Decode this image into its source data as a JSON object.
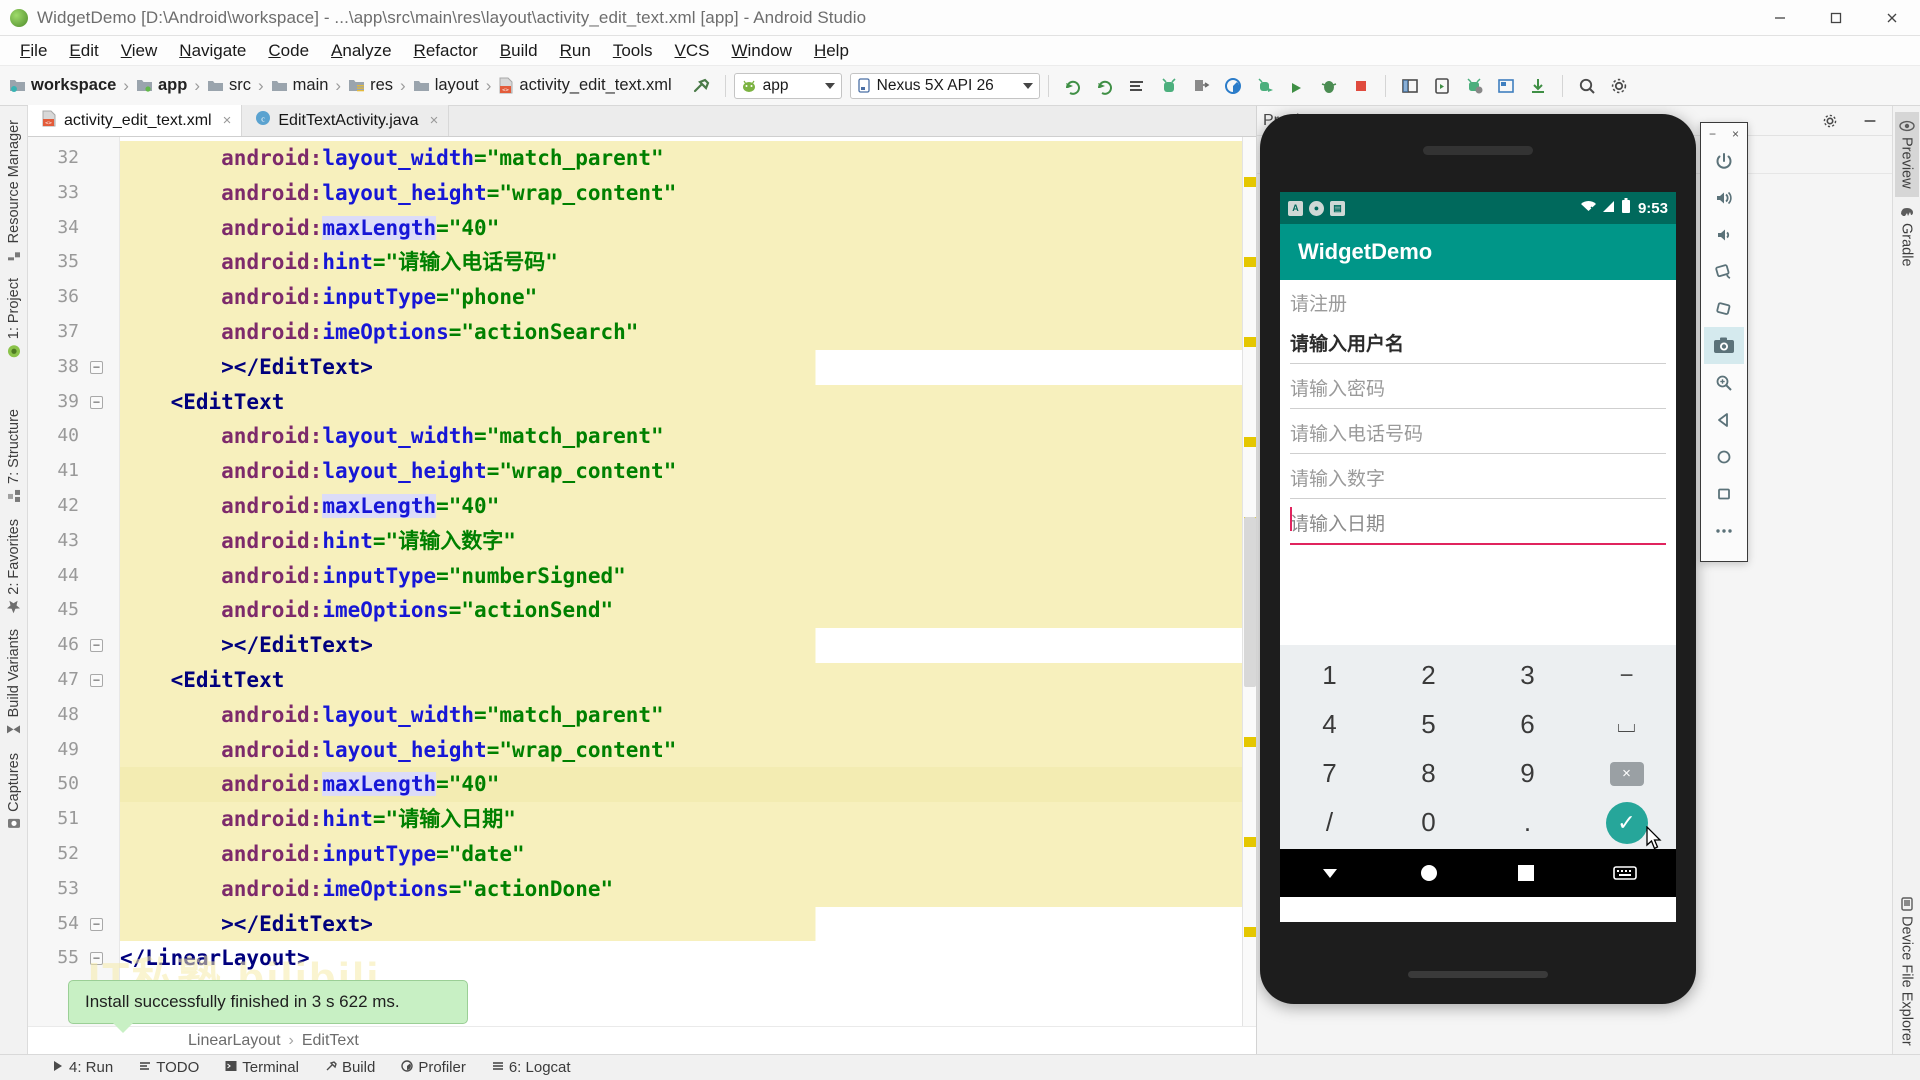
{
  "window": {
    "title": "WidgetDemo [D:\\Android\\workspace] - ...\\app\\src\\main\\res\\layout\\activity_edit_text.xml [app] - Android Studio",
    "minimize_label": "Minimize",
    "maximize_label": "Maximize",
    "close_label": "Close"
  },
  "menubar": [
    {
      "label": "File"
    },
    {
      "label": "Edit"
    },
    {
      "label": "View"
    },
    {
      "label": "Navigate"
    },
    {
      "label": "Code"
    },
    {
      "label": "Analyze"
    },
    {
      "label": "Refactor"
    },
    {
      "label": "Build"
    },
    {
      "label": "Run"
    },
    {
      "label": "Tools"
    },
    {
      "label": "VCS"
    },
    {
      "label": "Window"
    },
    {
      "label": "Help"
    }
  ],
  "navbar": {
    "breadcrumbs": [
      {
        "label": "workspace",
        "icon": "module-icon"
      },
      {
        "label": "app",
        "icon": "app-module-icon"
      },
      {
        "label": "src",
        "icon": "folder-icon"
      },
      {
        "label": "main",
        "icon": "folder-icon"
      },
      {
        "label": "res",
        "icon": "res-folder-icon"
      },
      {
        "label": "layout",
        "icon": "folder-icon"
      },
      {
        "label": "activity_edit_text.xml",
        "icon": "xml-file-icon"
      }
    ],
    "run_config": "app",
    "device": "Nexus 5X API 26",
    "tools": [
      {
        "name": "build-hammer-icon",
        "glyph": "⚒"
      },
      {
        "name": "sync-gradle-icon",
        "glyph": "↻"
      },
      {
        "name": "sync-project-icon",
        "glyph": "↻"
      },
      {
        "name": "avd-manager-icon",
        "glyph": "≡"
      },
      {
        "name": "sdk-manager-icon",
        "glyph": "⚙"
      },
      {
        "name": "run-icon",
        "glyph": "▶"
      },
      {
        "name": "debug-icon",
        "glyph": "☷"
      },
      {
        "name": "profile-icon",
        "glyph": "◔"
      },
      {
        "name": "attach-debugger-icon",
        "glyph": "⤳"
      },
      {
        "name": "stop-icon",
        "glyph": "■"
      },
      {
        "name": "project-structure-icon",
        "glyph": "▦"
      },
      {
        "name": "avd-icon",
        "glyph": "▣"
      },
      {
        "name": "sdk-icon",
        "glyph": "⚒"
      },
      {
        "name": "layout-inspector-icon",
        "glyph": "◫"
      },
      {
        "name": "download-icon",
        "glyph": "↧"
      },
      {
        "name": "search-everywhere-icon",
        "glyph": "⚲"
      },
      {
        "name": "settings-icon",
        "glyph": "⚙"
      }
    ]
  },
  "left_tool_strip": [
    {
      "label": "Resource Manager",
      "icon": "resource-manager-icon"
    },
    {
      "label": "1: Project",
      "icon": "project-icon"
    },
    {
      "label": "7: Structure",
      "icon": "structure-icon"
    },
    {
      "label": "2: Favorites",
      "icon": "star-icon"
    },
    {
      "label": "Build Variants",
      "icon": "build-variants-icon"
    },
    {
      "label": "Captures",
      "icon": "captures-icon"
    }
  ],
  "right_tool_strip": [
    {
      "label": "Preview",
      "icon": "eye-icon",
      "selected": true
    },
    {
      "label": "Gradle",
      "icon": "gradle-elephant-icon",
      "selected": false
    },
    {
      "label": "Device File Explorer",
      "icon": "device-file-explorer-icon",
      "selected": false
    }
  ],
  "editor": {
    "tabs": [
      {
        "label": "activity_edit_text.xml",
        "icon": "xml-file-icon",
        "active": true
      },
      {
        "label": "EditTextActivity.java",
        "icon": "java-class-icon",
        "active": false
      }
    ],
    "first_line_number": 32,
    "lines": [
      {
        "n": 32,
        "indent": 8,
        "tokens": [
          {
            "t": "android:",
            "c": "attr"
          },
          {
            "t": "layout_width",
            "c": "attr2"
          },
          {
            "t": "=",
            "c": "eq"
          },
          {
            "t": "\"match_parent\"",
            "c": "str"
          }
        ]
      },
      {
        "n": 33,
        "indent": 8,
        "tokens": [
          {
            "t": "android:",
            "c": "attr"
          },
          {
            "t": "layout_height",
            "c": "attr2"
          },
          {
            "t": "=",
            "c": "eq"
          },
          {
            "t": "\"wrap_content\"",
            "c": "str"
          }
        ]
      },
      {
        "n": 34,
        "indent": 8,
        "tokens": [
          {
            "t": "android:",
            "c": "attr"
          },
          {
            "t": "maxLength",
            "c": "attr2",
            "hl": true
          },
          {
            "t": "=",
            "c": "eq"
          },
          {
            "t": "\"40\"",
            "c": "str"
          }
        ]
      },
      {
        "n": 35,
        "indent": 8,
        "tokens": [
          {
            "t": "android:",
            "c": "attr"
          },
          {
            "t": "hint",
            "c": "attr2"
          },
          {
            "t": "=",
            "c": "eq"
          },
          {
            "t": "\"请输入电话号码\"",
            "c": "str"
          }
        ]
      },
      {
        "n": 36,
        "indent": 8,
        "tokens": [
          {
            "t": "android:",
            "c": "attr"
          },
          {
            "t": "inputType",
            "c": "attr2"
          },
          {
            "t": "=",
            "c": "eq"
          },
          {
            "t": "\"phone\"",
            "c": "str"
          }
        ]
      },
      {
        "n": 37,
        "indent": 8,
        "tokens": [
          {
            "t": "android:",
            "c": "attr"
          },
          {
            "t": "imeOptions",
            "c": "attr2"
          },
          {
            "t": "=",
            "c": "eq"
          },
          {
            "t": "\"actionSearch\"",
            "c": "str"
          }
        ]
      },
      {
        "n": 38,
        "indent": 8,
        "fold": true,
        "half": true,
        "tokens": [
          {
            "t": "></EditText>",
            "c": "tag"
          }
        ]
      },
      {
        "n": 39,
        "indent": 4,
        "fold": true,
        "tokens": [
          {
            "t": "<EditText",
            "c": "tag"
          }
        ]
      },
      {
        "n": 40,
        "indent": 8,
        "tokens": [
          {
            "t": "android:",
            "c": "attr"
          },
          {
            "t": "layout_width",
            "c": "attr2"
          },
          {
            "t": "=",
            "c": "eq"
          },
          {
            "t": "\"match_parent\"",
            "c": "str"
          }
        ]
      },
      {
        "n": 41,
        "indent": 8,
        "tokens": [
          {
            "t": "android:",
            "c": "attr"
          },
          {
            "t": "layout_height",
            "c": "attr2"
          },
          {
            "t": "=",
            "c": "eq"
          },
          {
            "t": "\"wrap_content\"",
            "c": "str"
          }
        ]
      },
      {
        "n": 42,
        "indent": 8,
        "tokens": [
          {
            "t": "android:",
            "c": "attr"
          },
          {
            "t": "maxLength",
            "c": "attr2",
            "hl": true
          },
          {
            "t": "=",
            "c": "eq"
          },
          {
            "t": "\"40\"",
            "c": "str"
          }
        ]
      },
      {
        "n": 43,
        "indent": 8,
        "tokens": [
          {
            "t": "android:",
            "c": "attr"
          },
          {
            "t": "hint",
            "c": "attr2"
          },
          {
            "t": "=",
            "c": "eq"
          },
          {
            "t": "\"请输入数字\"",
            "c": "str"
          }
        ]
      },
      {
        "n": 44,
        "indent": 8,
        "tokens": [
          {
            "t": "android:",
            "c": "attr"
          },
          {
            "t": "inputType",
            "c": "attr2"
          },
          {
            "t": "=",
            "c": "eq"
          },
          {
            "t": "\"numberSigned\"",
            "c": "str"
          }
        ]
      },
      {
        "n": 45,
        "indent": 8,
        "tokens": [
          {
            "t": "android:",
            "c": "attr"
          },
          {
            "t": "imeOptions",
            "c": "attr2"
          },
          {
            "t": "=",
            "c": "eq"
          },
          {
            "t": "\"actionSend\"",
            "c": "str"
          }
        ]
      },
      {
        "n": 46,
        "indent": 8,
        "fold": true,
        "half": true,
        "tokens": [
          {
            "t": "></EditText>",
            "c": "tag"
          }
        ]
      },
      {
        "n": 47,
        "indent": 4,
        "fold": true,
        "tokens": [
          {
            "t": "<EditText",
            "c": "tag"
          }
        ]
      },
      {
        "n": 48,
        "indent": 8,
        "tokens": [
          {
            "t": "android:",
            "c": "attr"
          },
          {
            "t": "layout_width",
            "c": "attr2"
          },
          {
            "t": "=",
            "c": "eq"
          },
          {
            "t": "\"match_parent\"",
            "c": "str"
          }
        ]
      },
      {
        "n": 49,
        "indent": 8,
        "tokens": [
          {
            "t": "android:",
            "c": "attr"
          },
          {
            "t": "layout_height",
            "c": "attr2"
          },
          {
            "t": "=",
            "c": "eq"
          },
          {
            "t": "\"wrap_content\"",
            "c": "str"
          }
        ]
      },
      {
        "n": 50,
        "indent": 8,
        "cur": true,
        "tokens": [
          {
            "t": "android:",
            "c": "attr"
          },
          {
            "t": "maxLength",
            "c": "attr2",
            "hl": true
          },
          {
            "t": "=",
            "c": "eq"
          },
          {
            "t": "\"40\"",
            "c": "str"
          }
        ]
      },
      {
        "n": 51,
        "indent": 8,
        "tokens": [
          {
            "t": "android:",
            "c": "attr"
          },
          {
            "t": "hint",
            "c": "attr2"
          },
          {
            "t": "=",
            "c": "eq"
          },
          {
            "t": "\"请输入日期\"",
            "c": "str"
          }
        ]
      },
      {
        "n": 52,
        "indent": 8,
        "tokens": [
          {
            "t": "android:",
            "c": "attr"
          },
          {
            "t": "inputType",
            "c": "attr2"
          },
          {
            "t": "=",
            "c": "eq"
          },
          {
            "t": "\"date\"",
            "c": "str"
          }
        ]
      },
      {
        "n": 53,
        "indent": 8,
        "tokens": [
          {
            "t": "android:",
            "c": "attr"
          },
          {
            "t": "imeOptions",
            "c": "attr2"
          },
          {
            "t": "=",
            "c": "eq"
          },
          {
            "t": "\"actionDone\"",
            "c": "str"
          }
        ]
      },
      {
        "n": 54,
        "indent": 8,
        "fold": true,
        "half": true,
        "tokens": [
          {
            "t": "></EditText>",
            "c": "tag"
          }
        ]
      },
      {
        "n": 55,
        "indent": 0,
        "fold": true,
        "plain": true,
        "tokens": [
          {
            "t": "</LinearLayout>",
            "c": "tag"
          }
        ]
      }
    ],
    "breadcrumb": [
      "LinearLayout",
      "EditText"
    ]
  },
  "preview_panel": {
    "title": "Preview",
    "settings_icon": "gear-icon",
    "minimize_icon": "minimize-icon"
  },
  "emulator": {
    "window_minimize": "−",
    "window_close": "×",
    "toolbar": [
      {
        "name": "power-icon",
        "label": "Power"
      },
      {
        "name": "volume-up-icon",
        "label": "Volume Up"
      },
      {
        "name": "volume-down-icon",
        "label": "Volume Down"
      },
      {
        "name": "rotate-left-icon",
        "label": "Rotate Left"
      },
      {
        "name": "rotate-right-icon",
        "label": "Rotate Right"
      },
      {
        "name": "screenshot-camera-icon",
        "label": "Take Screenshot",
        "selected": true
      },
      {
        "name": "zoom-magnifier-icon",
        "label": "Zoom"
      },
      {
        "name": "back-triangle-icon",
        "label": "Back"
      },
      {
        "name": "home-circle-icon",
        "label": "Home"
      },
      {
        "name": "overview-square-icon",
        "label": "Overview"
      },
      {
        "name": "more-ellipsis-icon",
        "label": "More"
      }
    ],
    "status_bar": {
      "left_icons": [
        "debug-icon",
        "sync-icon",
        "sdcard-icon"
      ],
      "wifi_icon": "wifi-off-icon",
      "signal_icon": "signal-icon",
      "battery_icon": "battery-icon",
      "time": "9:53"
    },
    "app_bar_title": "WidgetDemo",
    "fields": [
      {
        "text": "请注册",
        "state": "label"
      },
      {
        "text": "请输入用户名",
        "state": "filled"
      },
      {
        "text": "请输入密码",
        "state": "hint"
      },
      {
        "text": "请输入电话号码",
        "state": "hint"
      },
      {
        "text": "请输入数字",
        "state": "hint"
      },
      {
        "text": "请输入日期",
        "state": "active"
      }
    ],
    "keyboard": {
      "rows": [
        [
          {
            "k": "1"
          },
          {
            "k": "2"
          },
          {
            "k": "3"
          },
          {
            "k": "−",
            "type": "sym"
          }
        ],
        [
          {
            "k": "4"
          },
          {
            "k": "5"
          },
          {
            "k": "6"
          },
          {
            "k": "⌴",
            "type": "space"
          }
        ],
        [
          {
            "k": "7"
          },
          {
            "k": "8"
          },
          {
            "k": "9"
          },
          {
            "k": "⌫",
            "type": "delete"
          }
        ],
        [
          {
            "k": "/"
          },
          {
            "k": "0"
          },
          {
            "k": "."
          },
          {
            "k": "✓",
            "type": "done"
          }
        ]
      ]
    },
    "nav_bar": [
      {
        "name": "back-down-arrow-icon"
      },
      {
        "name": "home-circle-icon"
      },
      {
        "name": "recents-square-icon"
      },
      {
        "name": "keyboard-switch-icon"
      }
    ]
  },
  "notification": {
    "message": "Install successfully finished in 3 s 622 ms.",
    "watermark": "IT私塾 bilibili"
  },
  "statusbar": [
    {
      "label": "4: Run",
      "icon": "run-icon"
    },
    {
      "label": "TODO",
      "icon": "todo-icon"
    },
    {
      "label": "Terminal",
      "icon": "terminal-icon"
    },
    {
      "label": "Build",
      "icon": "build-icon"
    },
    {
      "label": "Profiler",
      "icon": "profiler-icon"
    },
    {
      "label": "6: Logcat",
      "icon": "logcat-icon"
    }
  ],
  "colors": {
    "accent_teal": "#009688",
    "status_teal": "#00695c",
    "code_highlight": "#f7f0bd",
    "attr_purple": "#7d2a6b",
    "attr_blue": "#1616d6",
    "string_green": "#008000",
    "tag_navy": "#00007d",
    "balloon_green": "#c8f0c4",
    "active_field_pink": "#e0245e"
  }
}
